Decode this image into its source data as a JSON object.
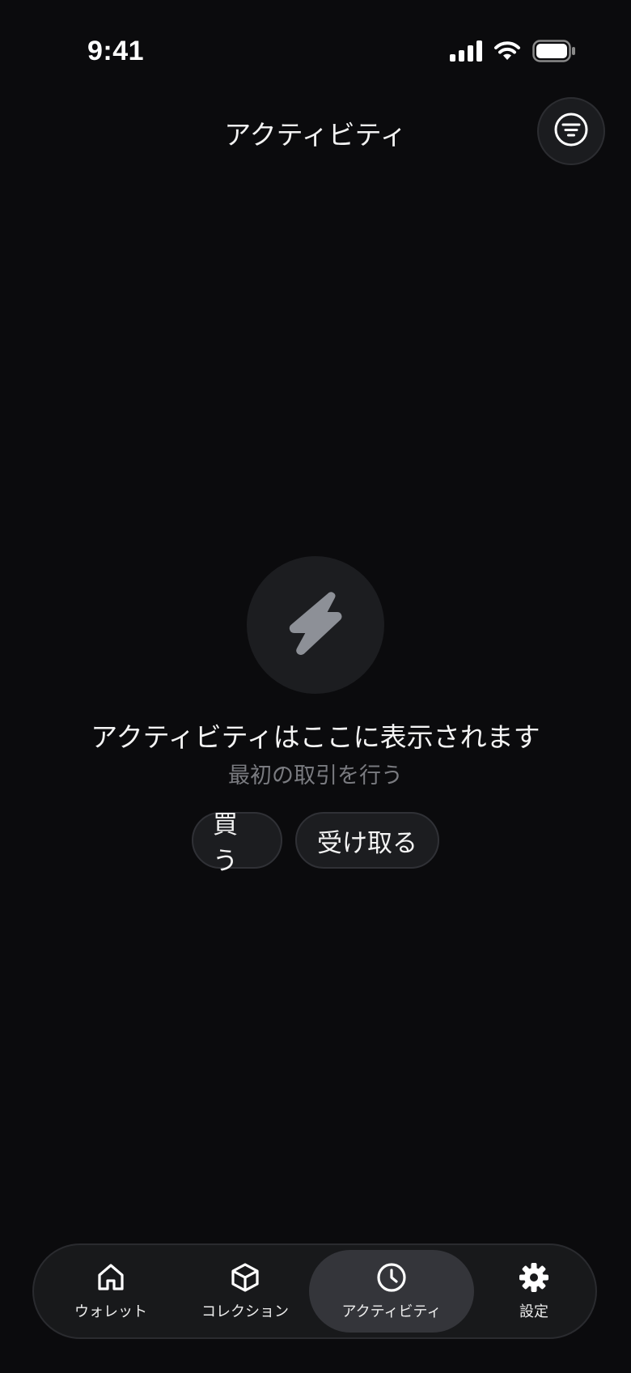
{
  "status_bar": {
    "time": "9:41",
    "icons": [
      "cellular-signal-icon",
      "wifi-icon",
      "battery-icon"
    ]
  },
  "header": {
    "title": "アクティビティ",
    "filter_icon": "filter-icon"
  },
  "empty_state": {
    "icon": "lightning-bolt-icon",
    "title": "アクティビティはここに表示されます",
    "subtitle": "最初の取引を行う",
    "actions": {
      "buy": "買う",
      "receive": "受け取る"
    }
  },
  "tab_bar": {
    "active": "activity",
    "items": [
      {
        "id": "wallet",
        "label": "ウォレット",
        "icon": "home-icon"
      },
      {
        "id": "collection",
        "label": "コレクション",
        "icon": "cube-icon"
      },
      {
        "id": "activity",
        "label": "アクティビティ",
        "icon": "clock-icon"
      },
      {
        "id": "settings",
        "label": "設定",
        "icon": "gear-icon"
      }
    ]
  },
  "colors": {
    "background": "#0b0b0d",
    "surface": "#1c1d20",
    "active_tab": "#34353a",
    "muted_text": "#7a7b80",
    "icon_muted": "#8d9097"
  }
}
